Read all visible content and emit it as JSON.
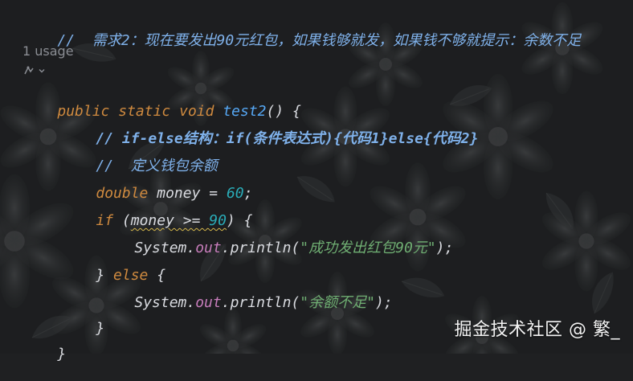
{
  "editor": {
    "header_comment": "//  需求2：现在要发出90元红包，如果钱够就发，如果钱不够就提示：余数不足",
    "usage_hint": "1 usage",
    "author_icon": "author-avatar-icon",
    "author_chevron": "chevron-down-icon",
    "lines": {
      "l1_kw1": "public",
      "l1_kw2": "static",
      "l1_kw3": "void",
      "l1_fn": "test2",
      "l1_rest": "() {",
      "l2_comment": "// if-else结构：if(条件表达式){代码1}else{代码2}",
      "l3_comment": "//  定义钱包余额",
      "l4_type": "double",
      "l4_rest": "money = ",
      "l4_num": "60",
      "l4_semicolon": ";",
      "l5_kw": "if",
      "l5_open": " (",
      "l5_cond": "money >= ",
      "l5_num": "90",
      "l5_close": ") {",
      "l6_sys": "System.",
      "l6_out": "out",
      "l6_println": ".println(",
      "l6_str": "\"成功发出红包90元\"",
      "l6_end": ");",
      "l7_brace": "} ",
      "l7_else": "else",
      "l7_open": " {",
      "l8_sys": "System.",
      "l8_out": "out",
      "l8_println": ".println(",
      "l8_str": "\"余额不足\"",
      "l8_end": ");",
      "l9_brace": "}",
      "l10_brace": "}"
    }
  },
  "watermark": "掘金技术社区 @ 繁_",
  "colors": {
    "background": "#1f2022",
    "comment": "#7fb1ea",
    "keyword": "#cf8a3f",
    "function": "#56a8f5",
    "number": "#2aacb8",
    "string": "#6fae72",
    "field": "#c77dbb",
    "plain": "#d9dbe0"
  }
}
